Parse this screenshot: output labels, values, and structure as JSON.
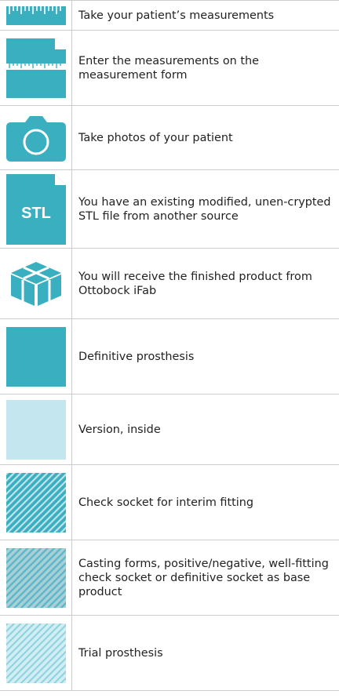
{
  "rows": [
    {
      "icon": "ruler-icon",
      "text": "Take your patient’s measurements"
    },
    {
      "icon": "measurement-form-icon",
      "text": "Enter the measurements on the measurement form"
    },
    {
      "icon": "camera-icon",
      "text": "Take photos of your patient"
    },
    {
      "icon": "stl-file-icon",
      "icon_label": "STL",
      "text": "You have an existing modified, unen-crypted STL file from another source"
    },
    {
      "icon": "box-icon",
      "text": "You will receive the finished product from Ottobock iFab"
    },
    {
      "icon": "solid-swatch-icon",
      "color": "#3aafc0",
      "text": "Definitive prosthesis"
    },
    {
      "icon": "light-swatch-icon",
      "color": "#c4e6ee",
      "text": "Version, inside"
    },
    {
      "icon": "hatched-swatch-icon",
      "color": "#3aafc0",
      "text": "Check socket for interim fitting"
    },
    {
      "icon": "gray-hatched-swatch-icon",
      "color": "#5bb8c8",
      "text": "Casting forms, positive/negative, well-fitting check socket or definitive socket as base product"
    },
    {
      "icon": "light-hatched-swatch-icon",
      "color": "#8fd3e0",
      "text": "Trial prosthesis"
    }
  ],
  "colors": {
    "accent": "#3aafc0",
    "light": "#c4e6ee",
    "border": "#c9cdd0"
  }
}
